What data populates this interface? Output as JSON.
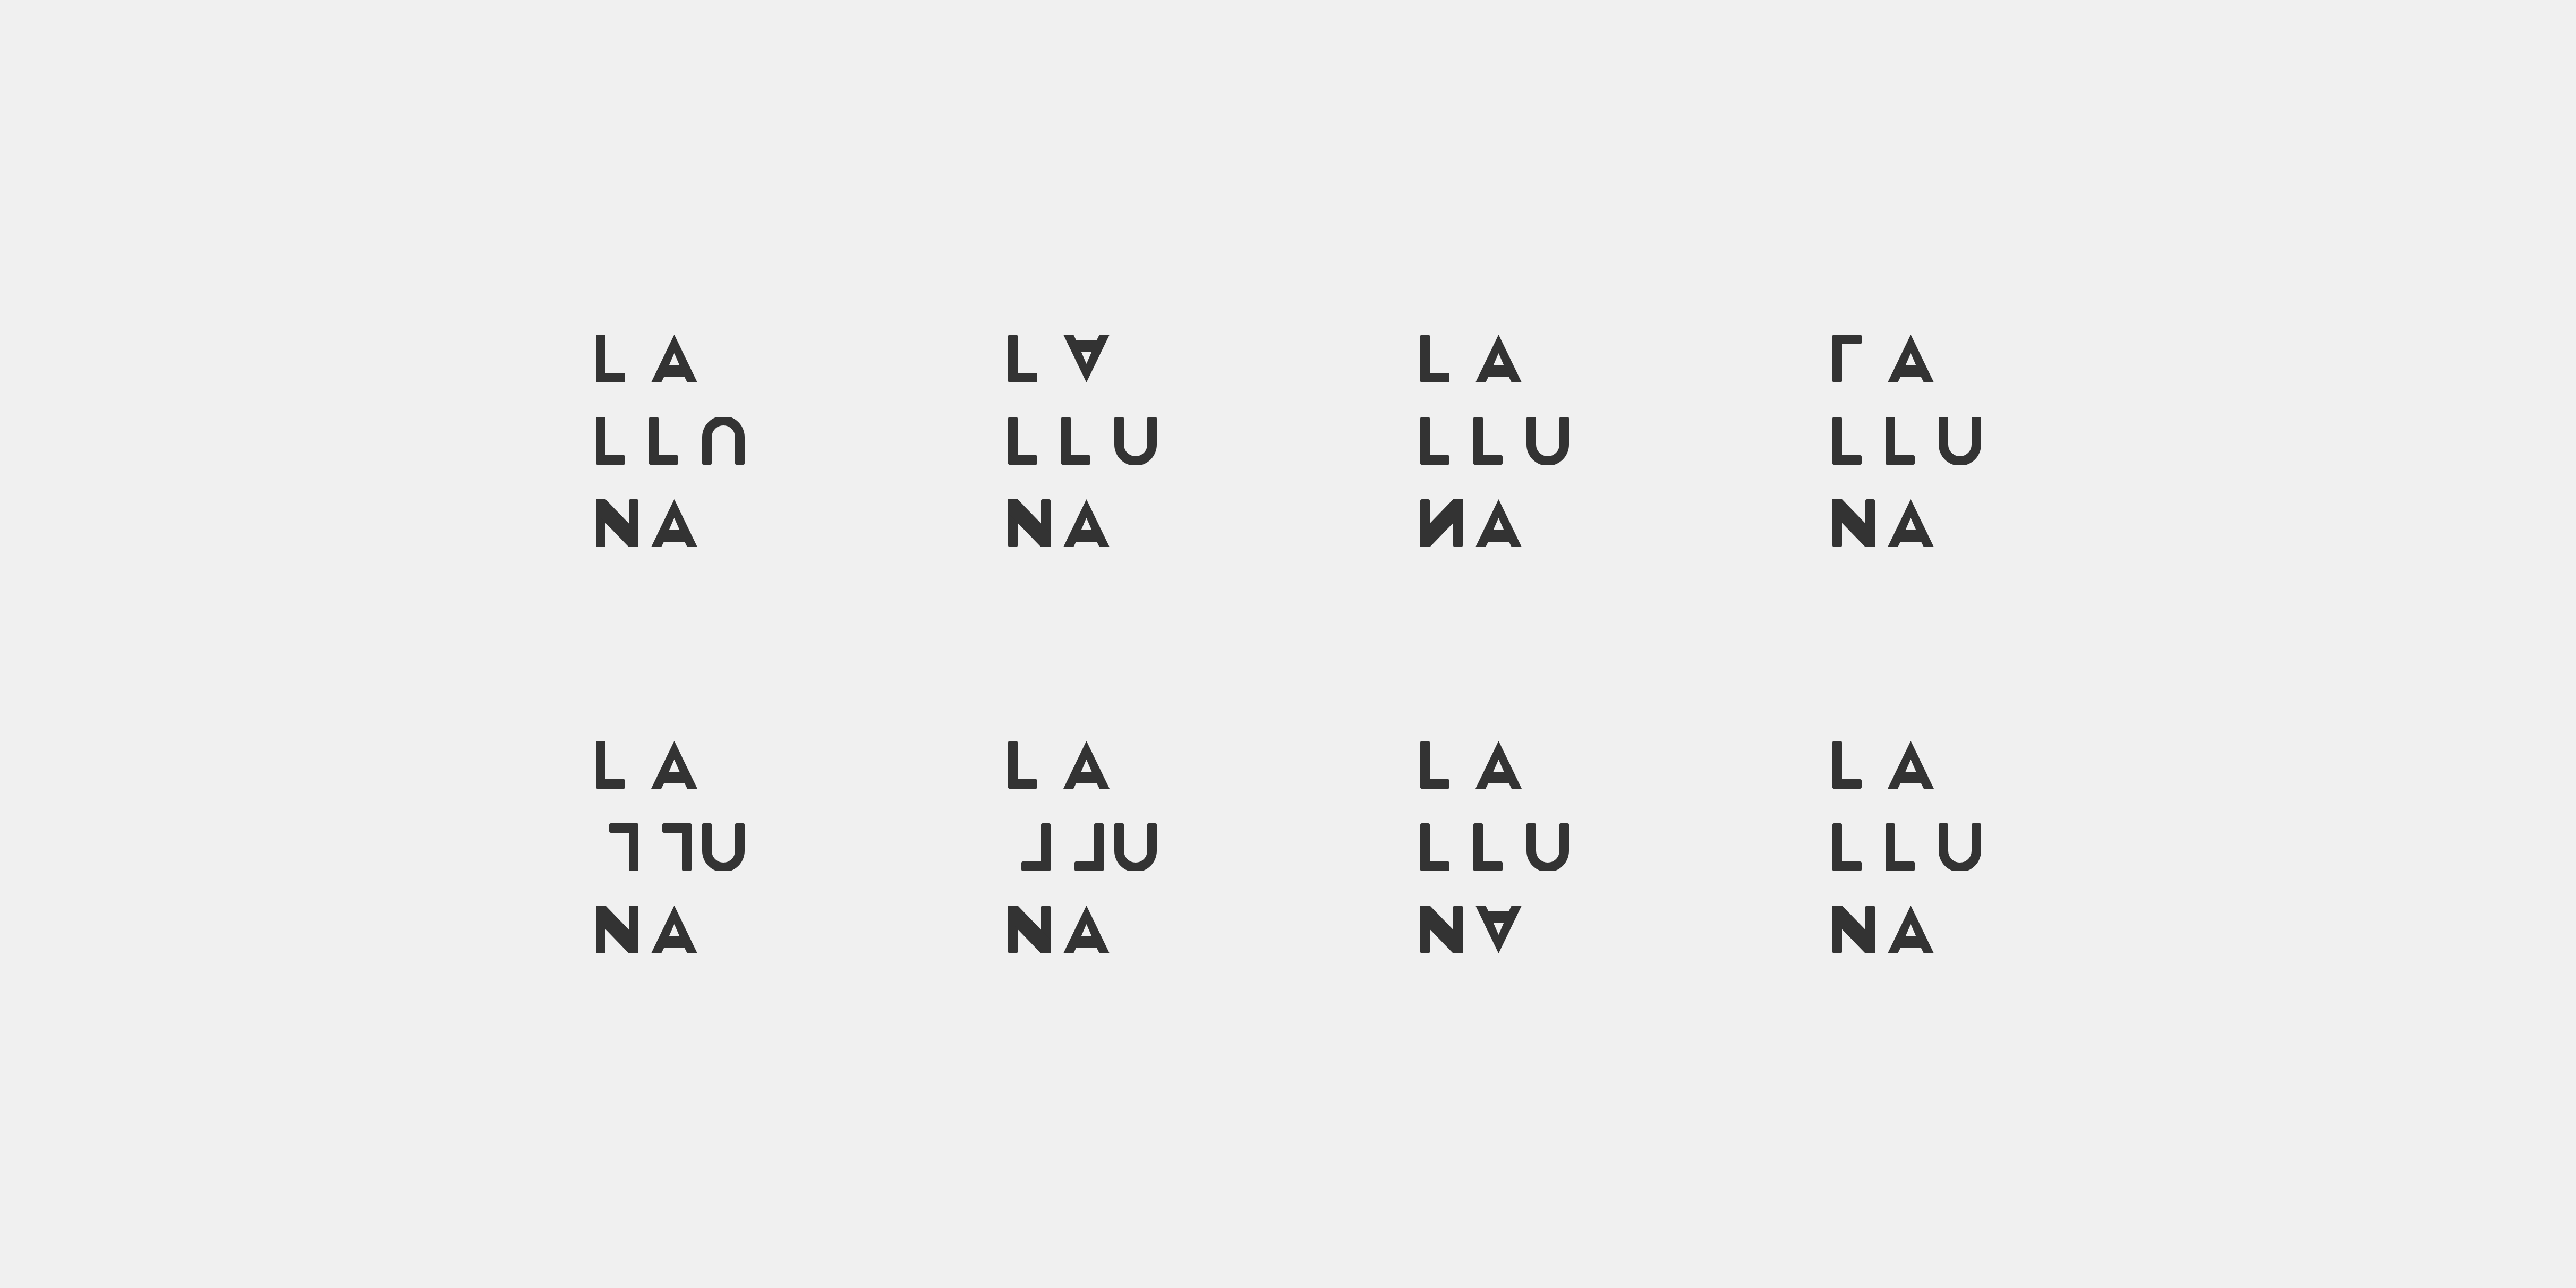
{
  "colors": {
    "background": "#f0f0f0",
    "ink": "#333333"
  },
  "logo": {
    "brand_lines": [
      "LA",
      "LLUNA",
      "NA"
    ],
    "variants": [
      {
        "variant": 1,
        "lines": [
          [
            "L",
            "A"
          ],
          [
            "L",
            "L",
            "U"
          ],
          [
            "N",
            "A"
          ]
        ],
        "flipped": [
          {
            "line": 1,
            "char": 2,
            "transform": "rotate-180"
          }
        ]
      },
      {
        "variant": 2,
        "lines": [
          [
            "L",
            "A"
          ],
          [
            "L",
            "L",
            "U"
          ],
          [
            "N",
            "A"
          ]
        ],
        "flipped": [
          {
            "line": 0,
            "char": 1,
            "transform": "flip-vertical"
          }
        ]
      },
      {
        "variant": 3,
        "lines": [
          [
            "L",
            "A"
          ],
          [
            "L",
            "L",
            "U"
          ],
          [
            "N",
            "A"
          ]
        ],
        "flipped": [
          {
            "line": 2,
            "char": 0,
            "transform": "flip-horizontal"
          }
        ]
      },
      {
        "variant": 4,
        "lines": [
          [
            "L",
            "A"
          ],
          [
            "L",
            "L",
            "U"
          ],
          [
            "N",
            "A"
          ]
        ],
        "flipped": [
          {
            "line": 0,
            "char": 0,
            "transform": "flip-vertical"
          }
        ]
      },
      {
        "variant": 5,
        "lines": [
          [
            "L",
            "A"
          ],
          [
            "L",
            "L",
            "U"
          ],
          [
            "N",
            "A"
          ]
        ],
        "flipped": [
          {
            "line": 1,
            "char": 0,
            "transform": "rotate-180"
          },
          {
            "line": 1,
            "char": 1,
            "transform": "rotate-180"
          }
        ]
      },
      {
        "variant": 6,
        "lines": [
          [
            "L",
            "A"
          ],
          [
            "L",
            "L",
            "U"
          ],
          [
            "N",
            "A"
          ]
        ],
        "flipped": [
          {
            "line": 1,
            "char": 0,
            "transform": "flip-horizontal"
          },
          {
            "line": 1,
            "char": 1,
            "transform": "flip-horizontal"
          }
        ]
      },
      {
        "variant": 7,
        "lines": [
          [
            "L",
            "A"
          ],
          [
            "L",
            "L",
            "U"
          ],
          [
            "N",
            "A"
          ]
        ],
        "flipped": [
          {
            "line": 2,
            "char": 1,
            "transform": "flip-vertical"
          }
        ]
      },
      {
        "variant": 8,
        "lines": [
          [
            "L",
            "A"
          ],
          [
            "L",
            "L",
            "U"
          ],
          [
            "N",
            "A"
          ]
        ],
        "flipped": []
      }
    ]
  }
}
